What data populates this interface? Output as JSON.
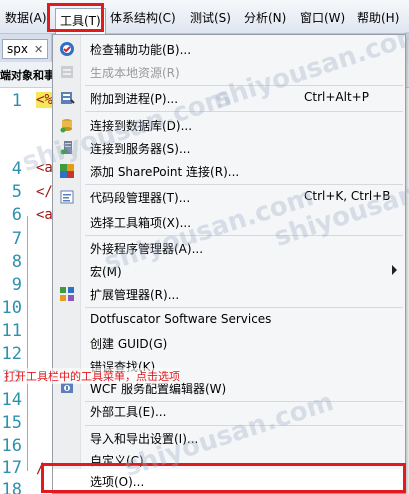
{
  "menubar": {
    "items": [
      "数据(A)",
      "工具(T)",
      "体系结构(C)",
      "测试(S)",
      "分析(N)",
      "窗口(W)",
      "帮助(H)"
    ]
  },
  "editor": {
    "tab_label": "spx",
    "tab_close": "✕",
    "selector_text": "端对象和事",
    "line_numbers": [
      "1",
      "4",
      "5",
      "6",
      "7",
      "8",
      "9",
      "10",
      "11",
      "12",
      "13",
      "14",
      "15",
      "16",
      "17",
      "18"
    ],
    "code_lines": [
      "<%",
      "<a",
      "</",
      "<a",
      "/"
    ]
  },
  "tools_menu": {
    "items": [
      {
        "label": "检查辅助功能(B)...",
        "shortcut": "",
        "icon": "accessibility-check-icon",
        "disabled": false,
        "submenu": false
      },
      {
        "label": "生成本地资源(R)",
        "shortcut": "",
        "icon": "generate-resource-icon",
        "disabled": true,
        "submenu": false
      },
      {
        "label": "附加到进程(P)...",
        "shortcut": "Ctrl+Alt+P",
        "icon": "attach-process-icon",
        "disabled": false,
        "submenu": false
      },
      {
        "label": "连接到数据库(D)...",
        "shortcut": "",
        "icon": "connect-database-icon",
        "disabled": false,
        "submenu": false
      },
      {
        "label": "连接到服务器(S)...",
        "shortcut": "",
        "icon": "connect-server-icon",
        "disabled": false,
        "submenu": false
      },
      {
        "label": "添加 SharePoint 连接(R)...",
        "shortcut": "",
        "icon": "sharepoint-icon",
        "disabled": false,
        "submenu": false
      },
      {
        "label": "代码段管理器(T)...",
        "shortcut": "Ctrl+K, Ctrl+B",
        "icon": "snippet-manager-icon",
        "disabled": false,
        "submenu": false
      },
      {
        "label": "选择工具箱项(X)...",
        "shortcut": "",
        "icon": "",
        "disabled": false,
        "submenu": false
      },
      {
        "label": "外接程序管理器(A)...",
        "shortcut": "",
        "icon": "",
        "disabled": false,
        "submenu": false
      },
      {
        "label": "宏(M)",
        "shortcut": "",
        "icon": "",
        "disabled": false,
        "submenu": true
      },
      {
        "label": "扩展管理器(R)...",
        "shortcut": "",
        "icon": "extension-manager-icon",
        "disabled": false,
        "submenu": false
      },
      {
        "label": "Dotfuscator Software Services",
        "shortcut": "",
        "icon": "",
        "disabled": false,
        "submenu": false
      },
      {
        "label": "创建 GUID(G)",
        "shortcut": "",
        "icon": "",
        "disabled": false,
        "submenu": false
      },
      {
        "label": "错误查找(K)",
        "shortcut": "",
        "icon": "",
        "disabled": false,
        "submenu": false
      },
      {
        "label": "WCF 服务配置编辑器(W)",
        "shortcut": "",
        "icon": "wcf-config-icon",
        "disabled": false,
        "submenu": false
      },
      {
        "label": "外部工具(E)...",
        "shortcut": "",
        "icon": "",
        "disabled": false,
        "submenu": false
      },
      {
        "label": "导入和导出设置(I)...",
        "shortcut": "",
        "icon": "",
        "disabled": false,
        "submenu": false
      },
      {
        "label": "自定义(C)...",
        "shortcut": "",
        "icon": "",
        "disabled": false,
        "submenu": false
      },
      {
        "label": "选项(O)...",
        "shortcut": "",
        "icon": "",
        "disabled": false,
        "submenu": false
      }
    ]
  },
  "annotation": "打开工具栏中的工具菜单，点击选项",
  "watermarks": [
    "shiyousan.com",
    "shiyousan.com",
    "shiyousan.com",
    "shiyousan.com",
    "shiyousan.com"
  ],
  "colors": {
    "callout_red": "#e2191d",
    "line_number_blue": "#2b91af",
    "code_red": "#a31515",
    "highlight_yellow": "#f5e75a"
  }
}
